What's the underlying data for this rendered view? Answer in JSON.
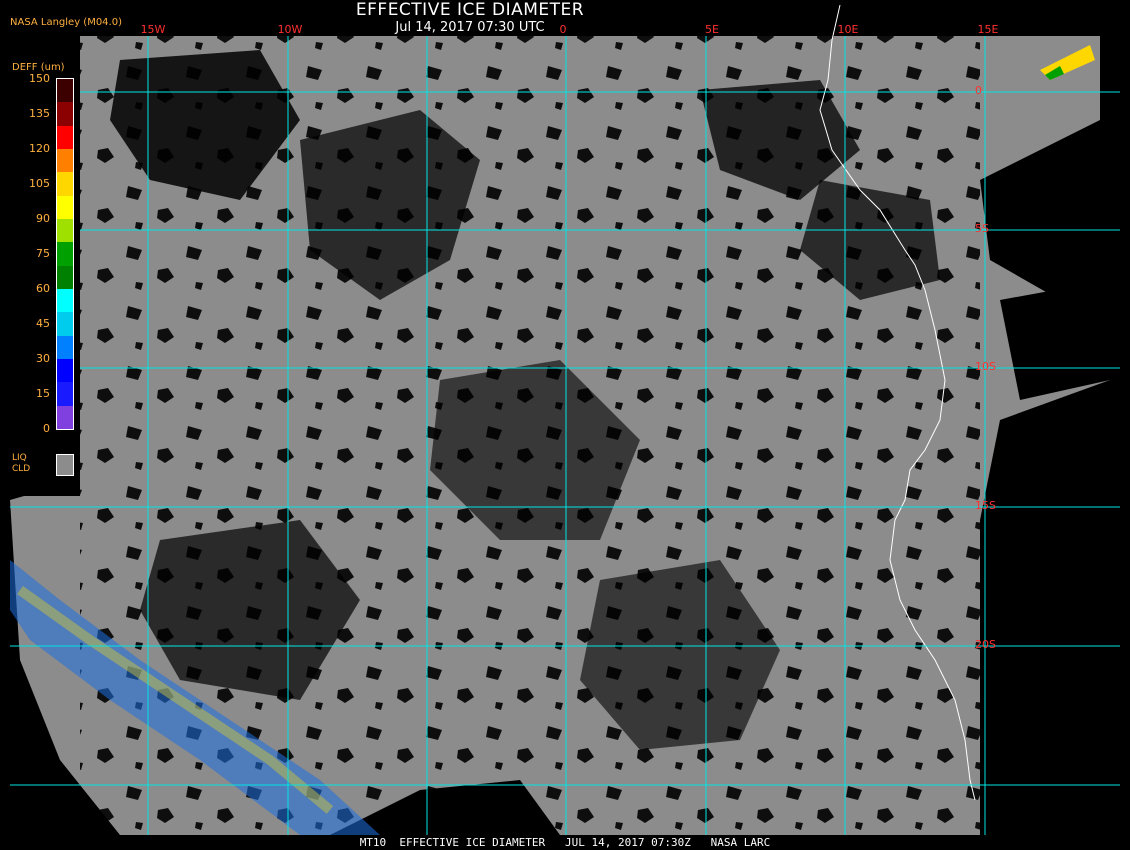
{
  "title": "EFFECTIVE ICE DIAMETER",
  "datetime": "Jul 14, 2017 07:30 UTC",
  "credit": "NASA Langley (M04.0)",
  "footer": "MT10  EFFECTIVE ICE DIAMETER   JUL 14, 2017 07:30Z   NASA LARC",
  "lon_labels": [
    "15W",
    "10W",
    "0",
    "5E",
    "10E",
    "15E"
  ],
  "lat_labels": [
    "0",
    "5S",
    "10S",
    "15S",
    "20S"
  ],
  "legend": {
    "title": "DEFF (um)",
    "ticks": [
      "150",
      "135",
      "120",
      "105",
      "90",
      "75",
      "60",
      "45",
      "30",
      "15",
      "0"
    ],
    "liquid_label_1": "LIQ",
    "liquid_label_2": "CLD",
    "colors_top_to_bottom": [
      "#3c0000",
      "#8b0000",
      "#ff0000",
      "#ff7f00",
      "#ffd700",
      "#ffff00",
      "#a0e000",
      "#00a000",
      "#008000",
      "#00ffff",
      "#00ccee",
      "#0080ff",
      "#0000ff",
      "#1a1aff",
      "#8040e0"
    ]
  },
  "colors": {
    "cloud": "#8c8c8c",
    "background": "#000000",
    "grid": "#00e5e5",
    "coast": "#ffffff",
    "labels": "#ff3030",
    "legend_text": "#ffb040"
  }
}
